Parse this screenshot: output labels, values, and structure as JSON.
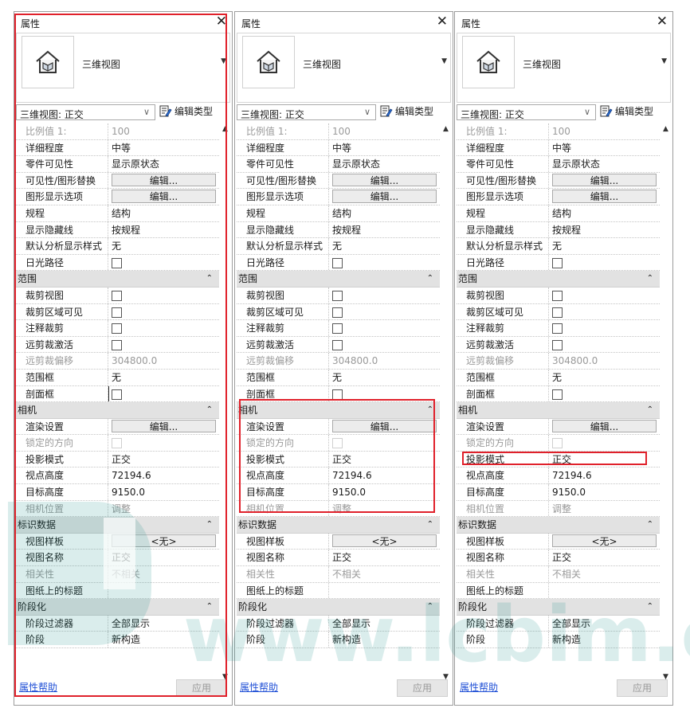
{
  "panel": {
    "title": "属性",
    "close": "✕",
    "type_name": "三维视图",
    "selector_value": "三维视图: 正交",
    "edit_type": "编辑类型",
    "help": "属性帮助",
    "apply": "应用",
    "rows": [
      {
        "k": "比例值 1:",
        "v": "100",
        "dis": true
      },
      {
        "k": "详细程度",
        "v": "中等"
      },
      {
        "k": "零件可见性",
        "v": "显示原状态"
      },
      {
        "k": "可见性/图形替换",
        "btn": "编辑..."
      },
      {
        "k": "图形显示选项",
        "btn": "编辑..."
      },
      {
        "k": "规程",
        "v": "结构"
      },
      {
        "k": "显示隐藏线",
        "v": "按规程"
      },
      {
        "k": "默认分析显示样式",
        "v": "无"
      },
      {
        "k": "日光路径",
        "cb": true
      },
      {
        "g": "范围"
      },
      {
        "k": "裁剪视图",
        "cb": true
      },
      {
        "k": "裁剪区域可见",
        "cb": true
      },
      {
        "k": "注释裁剪",
        "cb": true
      },
      {
        "k": "远剪裁激活",
        "cb": true
      },
      {
        "k": "远剪裁偏移",
        "v": "304800.0",
        "dis": true
      },
      {
        "k": "范围框",
        "v": "无"
      },
      {
        "k": "剖面框",
        "cb": true,
        "hl": true
      },
      {
        "g": "相机"
      },
      {
        "k": "渲染设置",
        "btn": "编辑..."
      },
      {
        "k": "锁定的方向",
        "cb": true,
        "dis": true
      },
      {
        "k": "投影模式",
        "v": "正交"
      },
      {
        "k": "视点高度",
        "v": "72194.6"
      },
      {
        "k": "目标高度",
        "v": "9150.0"
      },
      {
        "k": "相机位置",
        "v": "调整",
        "dis": true
      },
      {
        "g": "标识数据"
      },
      {
        "k": "视图样板",
        "btn": "<无>"
      },
      {
        "k": "视图名称",
        "v": "正交"
      },
      {
        "k": "相关性",
        "v": "不相关",
        "dis": true
      },
      {
        "k": "图纸上的标题",
        "v": ""
      },
      {
        "g": "阶段化"
      },
      {
        "k": "阶段过滤器",
        "v": "全部显示"
      },
      {
        "k": "阶段",
        "v": "新构造"
      }
    ]
  },
  "watermark": {
    "text": "www.lcbim.com",
    "color": "#1b8f8a"
  },
  "colors": {
    "highlight": "#e0212b",
    "group_bg": "#e2e2e2",
    "link": "#1f4fd6"
  }
}
